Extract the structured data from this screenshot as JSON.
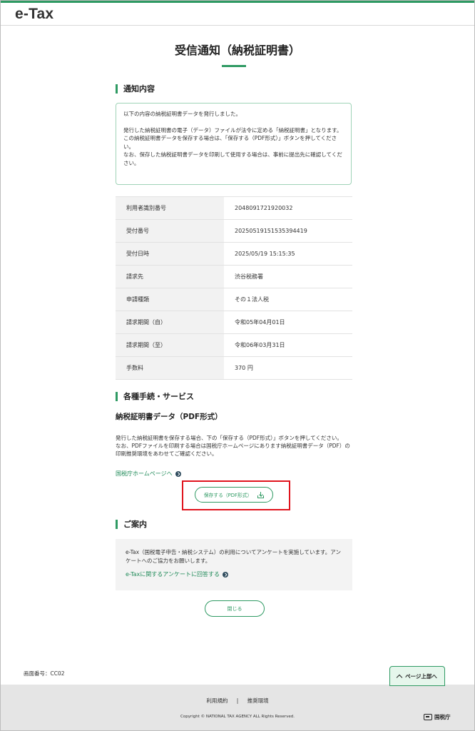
{
  "header": {
    "logo": "e-Tax"
  },
  "page_title": "受信通知（納税証明書）",
  "notice_section": {
    "heading": "通知内容",
    "lines": [
      "以下の内容の納税証明書データを発行しました。",
      "発行した納税証明書の電子（データ）ファイルが法令に定める「納税証明書」となります。",
      "この納税証明書データを保存する場合は、「保存する（PDF形式）」ボタンを押してください。",
      "なお、保存した納税証明書データを印刷して使用する場合は、事前に提出先に確認してください。"
    ]
  },
  "info_table": {
    "rows": [
      {
        "label": "利用者識別番号",
        "value": "2048091721920032"
      },
      {
        "label": "受付番号",
        "value": "20250519151535394419"
      },
      {
        "label": "受付日時",
        "value": "2025/05/19 15:15:35"
      },
      {
        "label": "請求先",
        "value": "渋谷税務署"
      },
      {
        "label": "申請種類",
        "value": "その１法人税"
      },
      {
        "label": "請求期間（自）",
        "value": "令和05年04月01日"
      },
      {
        "label": "請求期間（至）",
        "value": "令和06年03月31日"
      },
      {
        "label": "手数料",
        "value": "370 円"
      }
    ]
  },
  "services_section": {
    "heading": "各種手続・サービス",
    "subheading": "納税証明書データ（PDF形式）",
    "desc_lines": [
      "発行した納税証明書を保存する場合、下の「保存する（PDF形式）」ボタンを押してください。",
      "なお、PDFファイルを印刷する場合は国税庁ホームページにあります納税証明書データ（PDF）の印刷推奨環境をあわせてご確認ください。"
    ],
    "nta_link": "国税庁ホームページへ",
    "pdf_button": "保存する（PDF形式）"
  },
  "guide_section": {
    "heading": "ご案内",
    "text": "e-Tax（国税電子申告・納税システム）の利用についてアンケートを実施しています。アンケートへのご協力をお願いします。",
    "survey_link": "e-Taxに関するアンケートに回答する"
  },
  "close_button": "閉じる",
  "screen_id": "画面番号：CC02",
  "page_top_button": "ページ上部へ",
  "footer": {
    "links": [
      "利用規約",
      "推奨環境"
    ],
    "separator": "|",
    "copyright": "Copyright © NATIONAL TAX AGENCY ALL Rights Reserved.",
    "agency_logo": "国税庁"
  },
  "colors": {
    "accent": "#2f9a63",
    "highlight": "#e0141d",
    "link": "#1f8a58"
  },
  "icons": [
    "download-icon",
    "chevron-up-icon",
    "circle-arrow-icon"
  ]
}
